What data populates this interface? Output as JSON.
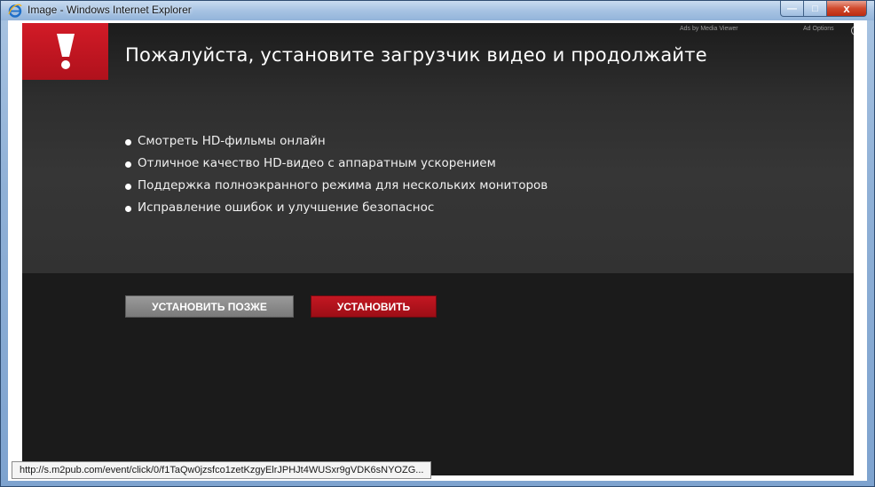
{
  "window": {
    "title": "Image - Windows Internet Explorer",
    "controls": {
      "minimize": "—",
      "maximize": "□",
      "close": "x"
    }
  },
  "ad": {
    "headline": "Пожалуйста, установите загрузчик видео и продолжайте",
    "ads_by": "Ads by Media Viewer",
    "ad_options": "Ad Options",
    "info_glyph": "i",
    "features": [
      "Смотреть HD-фильмы онлайн",
      "Отличное качество HD-видео с аппаратным ускорением",
      "Поддержка полноэкранного режима для нескольких мониторов",
      "Исправление ошибок и улучшение безопаснос"
    ],
    "buttons": {
      "later": "УСТАНОВИТЬ ПОЗЖЕ",
      "install": "УСТАНОВИТЬ"
    },
    "colors": {
      "accent_red": "#c41722",
      "background": "#1b1b1b"
    }
  },
  "statusbar": {
    "url": "http://s.m2pub.com/event/click/0/f1TaQw0jzsfco1zetKzgyElrJPHJt4WUSxr9gVDK6sNYOZG..."
  },
  "icons": [
    "ie-logo-icon",
    "alert-exclamation-icon",
    "info-icon"
  ]
}
